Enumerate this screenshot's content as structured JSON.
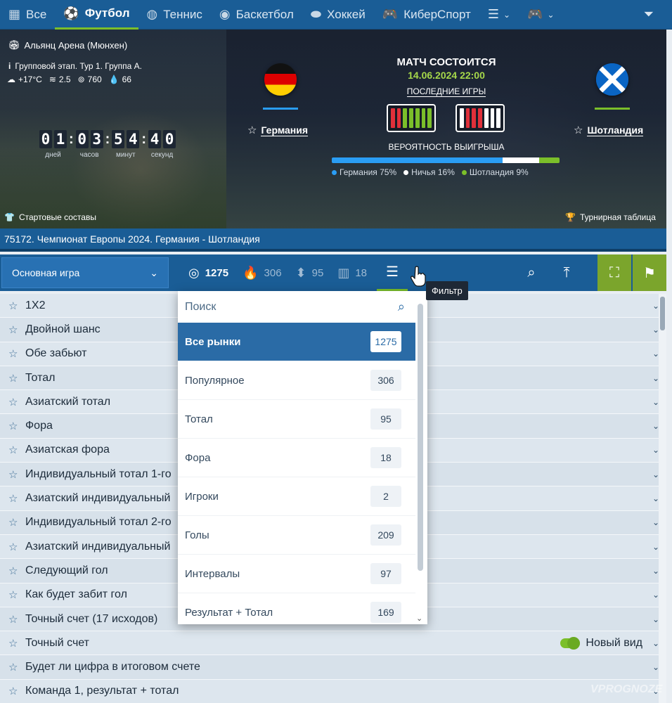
{
  "topnav": {
    "tabs": [
      {
        "label": "Все",
        "icon": "grid-icon"
      },
      {
        "label": "Футбол",
        "icon": "soccer-ball-icon",
        "active": true
      },
      {
        "label": "Теннис",
        "icon": "tennis-ball-icon"
      },
      {
        "label": "Баскетбол",
        "icon": "basketball-icon"
      },
      {
        "label": "Хоккей",
        "icon": "hockey-puck-icon"
      },
      {
        "label": "КиберСпорт",
        "icon": "gamepad-icon"
      }
    ]
  },
  "hero": {
    "venue": "Альянц Арена (Мюнхен)",
    "stage": "Групповой этап. Тур 1. Группа А.",
    "weather": {
      "temp": "+17°C",
      "wind": "2.5",
      "pressure": "760",
      "humidity": "66"
    },
    "countdown": {
      "days": "01",
      "hours": "03",
      "minutes": "54",
      "seconds": "40",
      "days_label": "дней",
      "hours_label": "часов",
      "minutes_label": "минут",
      "seconds_label": "секунд"
    },
    "lineups": "Стартовые составы",
    "standings": "Турнирная таблица",
    "team1": "Германия",
    "team2": "Шотландия",
    "status": "МАТЧ СОСТОИТСЯ",
    "datetime": "14.06.2024 22:00",
    "last_games": "ПОСЛЕДНИЕ ИГРЫ",
    "prob_title": "ВЕРОЯТНОСТЬ ВЫИГРЫША",
    "prob": {
      "team1_label": "Германия 75%",
      "draw_label": "Ничья 16%",
      "team2_label": "Шотландия 9%",
      "team1": 75,
      "draw": 16,
      "team2": 9
    },
    "colors": {
      "team1": "#2a9df4",
      "draw": "#ffffff",
      "team2": "#7bbf2a",
      "form_win": "#7bbf2a",
      "form_loss": "#e0303a"
    }
  },
  "event_title": "75172. Чемпионат Европы 2024. Германия - Шотландия",
  "toolbar": {
    "select": "Основная игра",
    "counts": {
      "all": "1275",
      "popular": "306",
      "total": "95",
      "handicap": "18"
    },
    "tooltip": "Фильтр"
  },
  "dropdown": {
    "search_placeholder": "Поиск",
    "items": [
      {
        "label": "Все рынки",
        "count": "1275"
      },
      {
        "label": "Популярное",
        "count": "306"
      },
      {
        "label": "Тотал",
        "count": "95"
      },
      {
        "label": "Фора",
        "count": "18"
      },
      {
        "label": "Игроки",
        "count": "2"
      },
      {
        "label": "Голы",
        "count": "209"
      },
      {
        "label": "Интервалы",
        "count": "97"
      },
      {
        "label": "Результат + Тотал",
        "count": "169"
      }
    ]
  },
  "markets": [
    "1X2",
    "Двойной шанс",
    "Обе забьют",
    "Тотал",
    "Азиатский тотал",
    "Фора",
    "Азиатская фора",
    "Индивидуальный тотал 1-го",
    "Азиатский индивидуальный",
    "Индивидуальный тотал 2-го",
    "Азиатский индивидуальный",
    "Следующий гол",
    "Как будет забит гол",
    "Точный счет (17 исходов)",
    "Точный счет",
    "Будет ли цифра в итоговом счете",
    "Команда 1, результат + тотал"
  ],
  "new_view": "Новый вид",
  "watermark": "VPROGNOZE"
}
